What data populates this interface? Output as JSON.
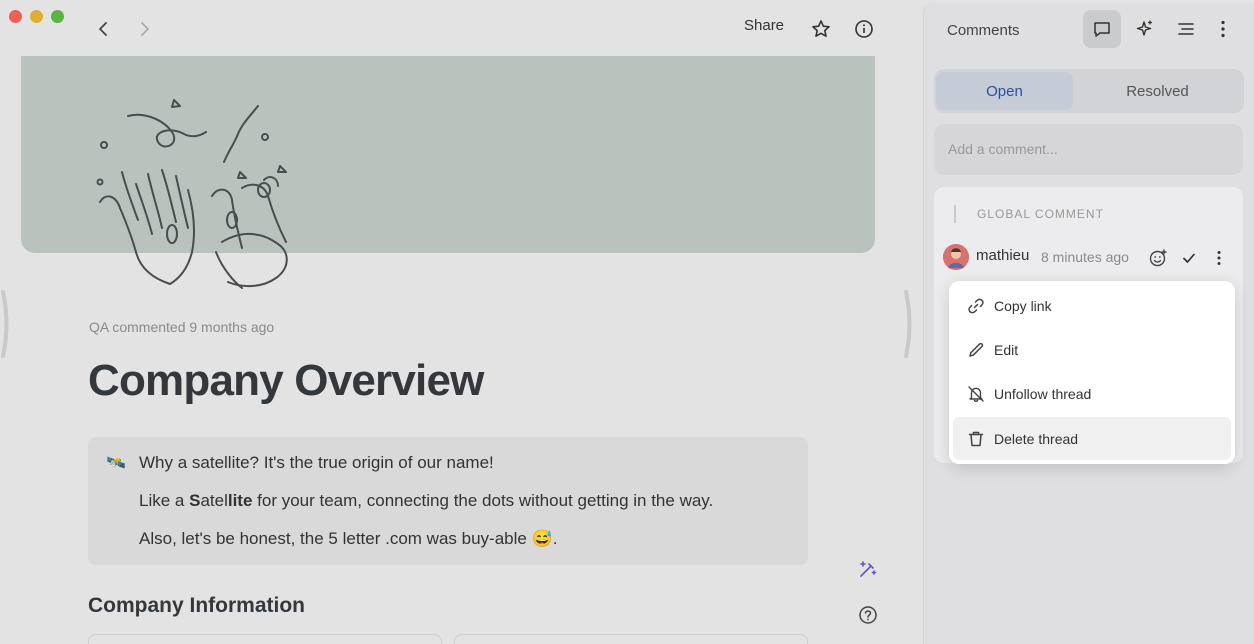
{
  "window": {
    "controls": [
      "close",
      "minimize",
      "zoom"
    ]
  },
  "toolbar": {
    "back_icon": "chevron-left-icon",
    "forward_icon": "chevron-right-icon",
    "share_label": "Share",
    "star_icon": "star-icon",
    "info_icon": "info-icon"
  },
  "document": {
    "meta": "QA commented 9 months ago",
    "title": "Company Overview",
    "callout": {
      "emoji": "🛰️",
      "line1": "Why a satellite? It's the true origin of our name!",
      "line2_pre": "Like a ",
      "line2_b1": "S",
      "line2_mid": "atel",
      "line2_b2": "lite",
      "line2_post": " for your team, connecting the dots without getting in the way.",
      "line3": "Also, let's be honest, the 5 letter .com was buy-able 😅."
    },
    "section_heading": "Company Information"
  },
  "panel": {
    "title": "Comments",
    "tabs": {
      "open": "Open",
      "resolved": "Resolved"
    },
    "add_placeholder": "Add a comment...",
    "thread": {
      "label": "GLOBAL COMMENT",
      "author": "mathieu",
      "time": "8 minutes ago"
    }
  },
  "menu": {
    "items": [
      {
        "label": "Copy link",
        "icon": "link-icon"
      },
      {
        "label": "Edit",
        "icon": "pencil-icon"
      },
      {
        "label": "Unfollow thread",
        "icon": "bell-off-icon"
      },
      {
        "label": "Delete thread",
        "icon": "trash-icon"
      }
    ]
  },
  "colors": {
    "cover": "#b9c3bd",
    "accent_blue": "#2b4f9e",
    "panel_bg": "#dfdfe1"
  }
}
